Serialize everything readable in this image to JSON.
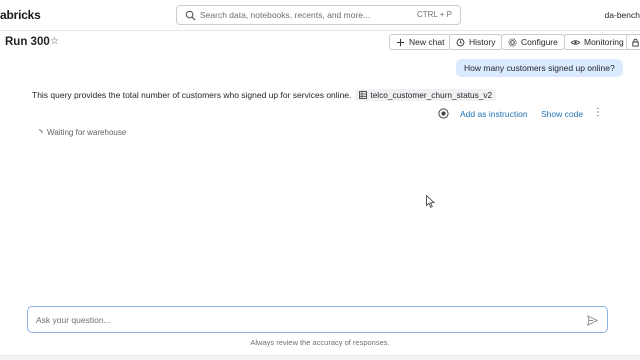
{
  "app": {
    "brand": "abricks",
    "user": "da-bench"
  },
  "search": {
    "placeholder": "Search data, notebooks, recents, and more...",
    "shortcut": "CTRL + P"
  },
  "header": {
    "title": "Run 300",
    "buttons": {
      "new_chat": "New chat",
      "history": "History",
      "configure": "Configure",
      "monitoring": "Monitoring"
    }
  },
  "chat": {
    "user_message": "How many customers signed up online?",
    "answer_text": "This query provides the total number of customers who signed up for services online.",
    "table_name": "telco_customer_churn_status_v2",
    "actions": {
      "add_instruction": "Add as instruction",
      "show_code": "Show code"
    },
    "status": "Waiting for warehouse"
  },
  "input": {
    "placeholder": "Ask your question...",
    "value": ""
  },
  "footer": {
    "disclaimer": "Always review the accuracy of responses."
  },
  "colors": {
    "accent": "#2272b4",
    "user_bubble": "#dbeafe",
    "border": "#c9ccd1"
  }
}
